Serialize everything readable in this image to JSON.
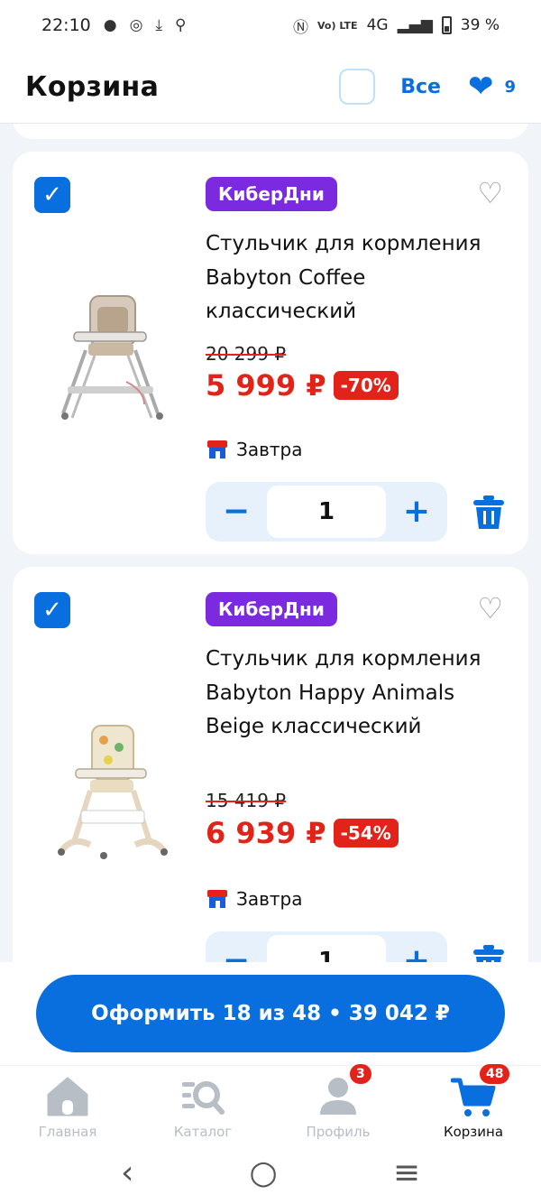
{
  "status_bar": {
    "time": "22:10",
    "network": "4G",
    "battery": "39 %",
    "volte": "Vo) LTE"
  },
  "header": {
    "title": "Корзина",
    "select_all_label": "Все",
    "favorites_count": "9"
  },
  "items": [
    {
      "badge": "КиберДни",
      "name": "Стульчик для кормления Babyton Coffee классический",
      "old_price": "20 299 ₽",
      "price": "5 999 ₽",
      "discount": "-70%",
      "delivery": "Завтра",
      "quantity": "1",
      "selected": true
    },
    {
      "badge": "КиберДни",
      "name": "Стульчик для кормления Babyton Happy Animals Beige классический",
      "old_price": "15 419 ₽",
      "price": "6 939 ₽",
      "discount": "-54%",
      "delivery": "Завтра",
      "quantity": "1",
      "selected": true
    }
  ],
  "checkout": {
    "label": "Оформить 18 из 48 • 39 042 ₽"
  },
  "bottom_nav": [
    {
      "label": "Главная",
      "icon": "home-icon"
    },
    {
      "label": "Каталог",
      "icon": "catalog-search-icon"
    },
    {
      "label": "Профиль",
      "icon": "profile-icon",
      "badge": "3"
    },
    {
      "label": "Корзина",
      "icon": "cart-icon",
      "badge": "48",
      "active": true
    }
  ],
  "colors": {
    "accent": "#0a6fde",
    "sale_red": "#e2231a",
    "badge_purple": "#7b2ae0"
  }
}
